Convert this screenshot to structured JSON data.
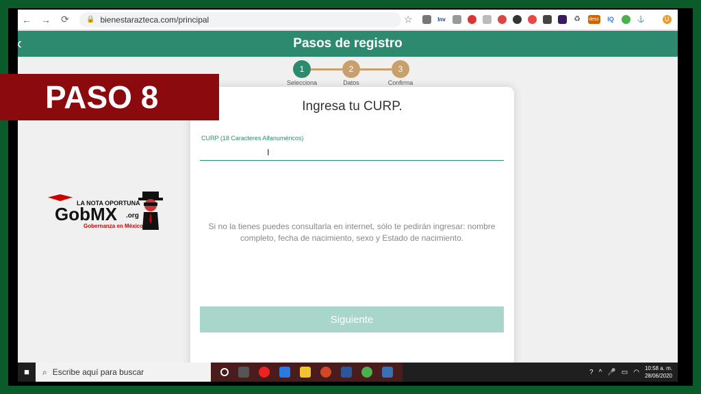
{
  "browser": {
    "url": "bienestarazteca.com/principal",
    "extensions": [
      "Inv",
      "IQ",
      "desc"
    ]
  },
  "header": {
    "title": "Pasos de registro",
    "back_icon": "chevron-left-icon"
  },
  "stepper": {
    "steps": [
      {
        "num": "1",
        "label": "Selecciona"
      },
      {
        "num": "2",
        "label": "Datos"
      },
      {
        "num": "3",
        "label": "Confirma"
      }
    ]
  },
  "card": {
    "title": "Ingresa tu CURP.",
    "field_label": "CURP (18 Caracteres Alfanuméricos)",
    "field_value": "",
    "hint": "Si no la tienes puedes consultarla en internet, sólo te pedirán ingresar: nombre completo, fecha de nacimiento, sexo y Estado de nacimiento.",
    "next_button": "Siguiente"
  },
  "overlay": {
    "banner": "PASO 8"
  },
  "logo": {
    "line1": "LA NOTA OPORTUNA",
    "line2": "GobMX",
    "line3": ".org",
    "line4": "Gobernanza en México"
  },
  "taskbar": {
    "search_placeholder": "Escribe aquí para buscar",
    "time": "10:58 a. m.",
    "date": "28/06/2020"
  },
  "colors": {
    "accent": "#2e8a6f",
    "step_pending": "#c9a06b",
    "banner": "#8b0a0e"
  }
}
